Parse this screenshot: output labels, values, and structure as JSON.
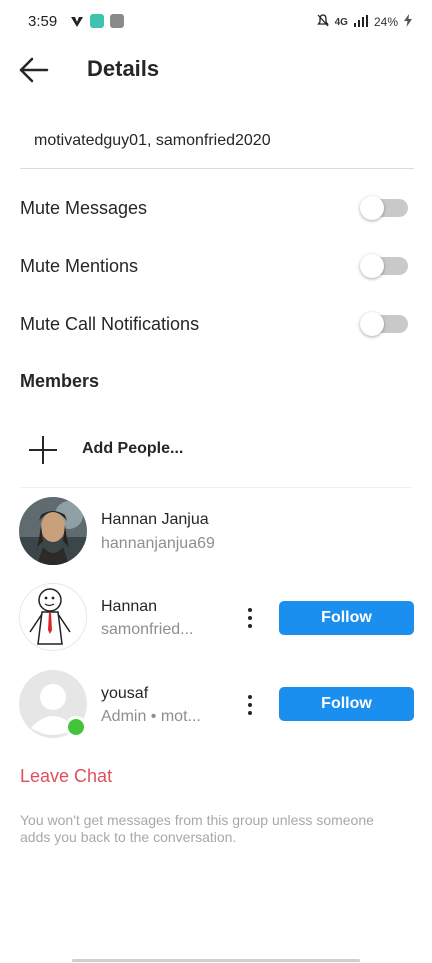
{
  "status_bar": {
    "time": "3:59",
    "network": "4G",
    "battery": "24%"
  },
  "header": {
    "title": "Details"
  },
  "group_name": "motivatedguy01, samonfried2020",
  "settings": [
    {
      "label": "Mute Messages",
      "enabled": false
    },
    {
      "label": "Mute Mentions",
      "enabled": false
    },
    {
      "label": "Mute Call Notifications",
      "enabled": false
    }
  ],
  "members": {
    "title": "Members",
    "add_label": "Add People...",
    "list": [
      {
        "name": "Hannan Janjua",
        "sub": "hannanjanjua69"
      },
      {
        "name": "Hannan",
        "sub": "samonfried...",
        "action": "Follow"
      },
      {
        "name": "yousaf",
        "sub": "Admin • mot...",
        "action": "Follow",
        "online": true
      }
    ]
  },
  "leave_label": "Leave Chat",
  "footer_note": "You won't get messages from this group unless someone adds you back to the conversation.",
  "colors": {
    "accent": "#1a8ff0",
    "danger": "#e0505b",
    "online": "#44c43a"
  }
}
